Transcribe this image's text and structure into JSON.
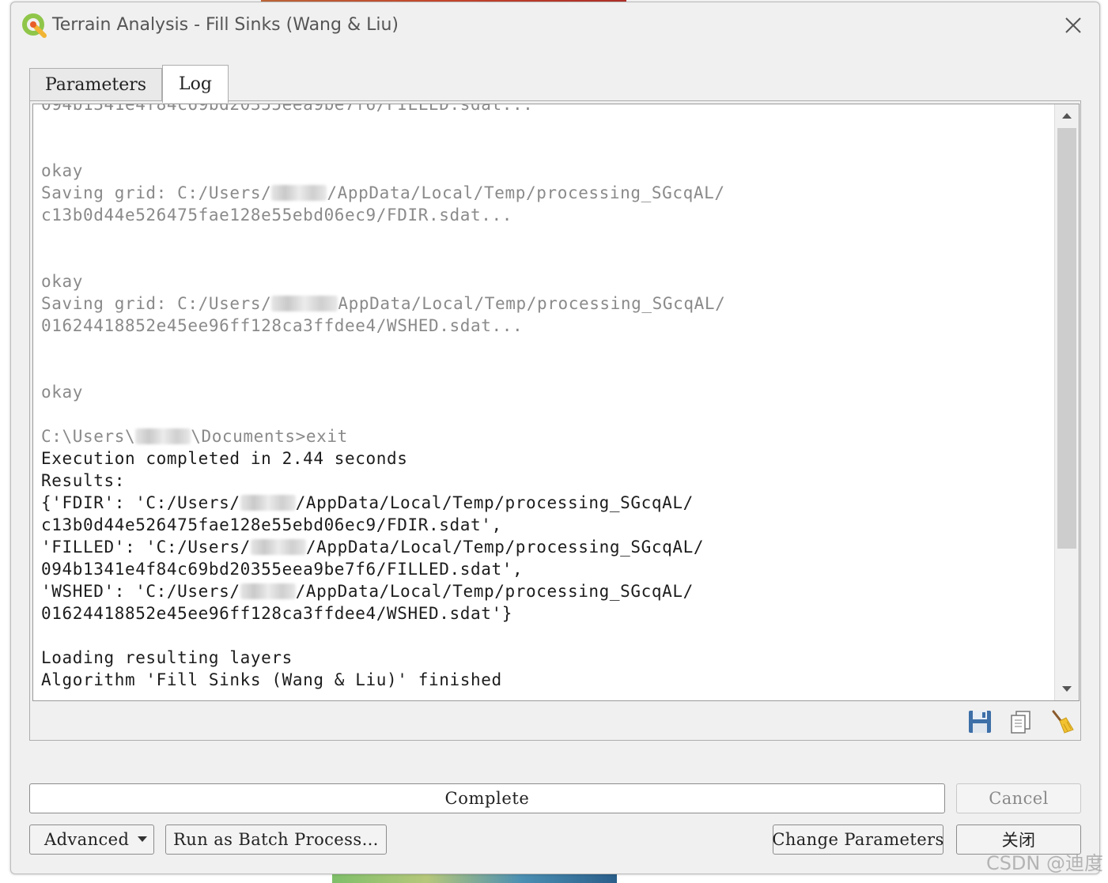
{
  "window": {
    "title": "Terrain Analysis - Fill Sinks (Wang & Liu)"
  },
  "tabs": [
    {
      "label": "Parameters",
      "active": false
    },
    {
      "label": "Log",
      "active": true
    }
  ],
  "log": {
    "lines": [
      {
        "segments": [
          {
            "text": "094b1341e4f84c69bd20355eea9be7f6/FILLED.sdat..."
          }
        ],
        "style": "gray"
      },
      {
        "segments": [
          {
            "text": ""
          }
        ],
        "style": "gray"
      },
      {
        "segments": [
          {
            "text": ""
          }
        ],
        "style": "gray"
      },
      {
        "segments": [
          {
            "text": "okay"
          }
        ],
        "style": "gray"
      },
      {
        "segments": [
          {
            "text": "Saving grid: C:/Users/"
          },
          {
            "redacted": true,
            "chars": 5
          },
          {
            "text": "/AppData/Local/Temp/processing_SGcqAL/"
          }
        ],
        "style": "gray"
      },
      {
        "segments": [
          {
            "text": "c13b0d44e526475fae128e55ebd06ec9/FDIR.sdat..."
          }
        ],
        "style": "gray"
      },
      {
        "segments": [
          {
            "text": ""
          }
        ],
        "style": "gray"
      },
      {
        "segments": [
          {
            "text": ""
          }
        ],
        "style": "gray"
      },
      {
        "segments": [
          {
            "text": "okay"
          }
        ],
        "style": "gray"
      },
      {
        "segments": [
          {
            "text": "Saving grid: C:/Users/"
          },
          {
            "redacted": true,
            "chars": 6
          },
          {
            "text": "AppData/Local/Temp/processing_SGcqAL/"
          }
        ],
        "style": "gray"
      },
      {
        "segments": [
          {
            "text": "01624418852e45ee96ff128ca3ffdee4/WSHED.sdat..."
          }
        ],
        "style": "gray"
      },
      {
        "segments": [
          {
            "text": ""
          }
        ],
        "style": "gray"
      },
      {
        "segments": [
          {
            "text": ""
          }
        ],
        "style": "gray"
      },
      {
        "segments": [
          {
            "text": "okay"
          }
        ],
        "style": "gray"
      },
      {
        "segments": [
          {
            "text": ""
          }
        ],
        "style": "gray"
      },
      {
        "segments": [
          {
            "text": "C:\\Users\\"
          },
          {
            "redacted": true,
            "chars": 5
          },
          {
            "text": "\\Documents>exit"
          }
        ],
        "style": "gray"
      },
      {
        "segments": [
          {
            "text": "Execution completed in 2.44 seconds"
          }
        ],
        "style": "dark"
      },
      {
        "segments": [
          {
            "text": "Results:"
          }
        ],
        "style": "dark"
      },
      {
        "segments": [
          {
            "text": "{'FDIR': 'C:/Users/"
          },
          {
            "redacted": true,
            "chars": 5
          },
          {
            "text": "/AppData/Local/Temp/processing_SGcqAL/"
          }
        ],
        "style": "dark"
      },
      {
        "segments": [
          {
            "text": "c13b0d44e526475fae128e55ebd06ec9/FDIR.sdat',"
          }
        ],
        "style": "dark"
      },
      {
        "segments": [
          {
            "text": "'FILLED': 'C:/Users/"
          },
          {
            "redacted": true,
            "chars": 5
          },
          {
            "text": "/AppData/Local/Temp/processing_SGcqAL/"
          }
        ],
        "style": "dark"
      },
      {
        "segments": [
          {
            "text": "094b1341e4f84c69bd20355eea9be7f6/FILLED.sdat',"
          }
        ],
        "style": "dark"
      },
      {
        "segments": [
          {
            "text": "'WSHED': 'C:/Users/"
          },
          {
            "redacted": true,
            "chars": 5
          },
          {
            "text": "/AppData/Local/Temp/processing_SGcqAL/"
          }
        ],
        "style": "dark"
      },
      {
        "segments": [
          {
            "text": "01624418852e45ee96ff128ca3ffdee4/WSHED.sdat'}"
          }
        ],
        "style": "dark"
      },
      {
        "segments": [
          {
            "text": ""
          }
        ],
        "style": "dark"
      },
      {
        "segments": [
          {
            "text": "Loading resulting layers"
          }
        ],
        "style": "dark"
      },
      {
        "segments": [
          {
            "text": "Algorithm 'Fill Sinks (Wang & Liu)' finished"
          }
        ],
        "style": "dark"
      }
    ]
  },
  "log_toolbar": {
    "save_icon": "save-icon",
    "copy_icon": "copy-icon",
    "clear_icon": "clear-broom-icon"
  },
  "progress": {
    "label": "Complete",
    "value": 1.0
  },
  "buttons": {
    "cancel": "Cancel",
    "advanced": "Advanced",
    "batch": "Run as Batch Process…",
    "change_parameters": "Change Parameters",
    "close": "关闭"
  },
  "watermark": "CSDN @迪度"
}
